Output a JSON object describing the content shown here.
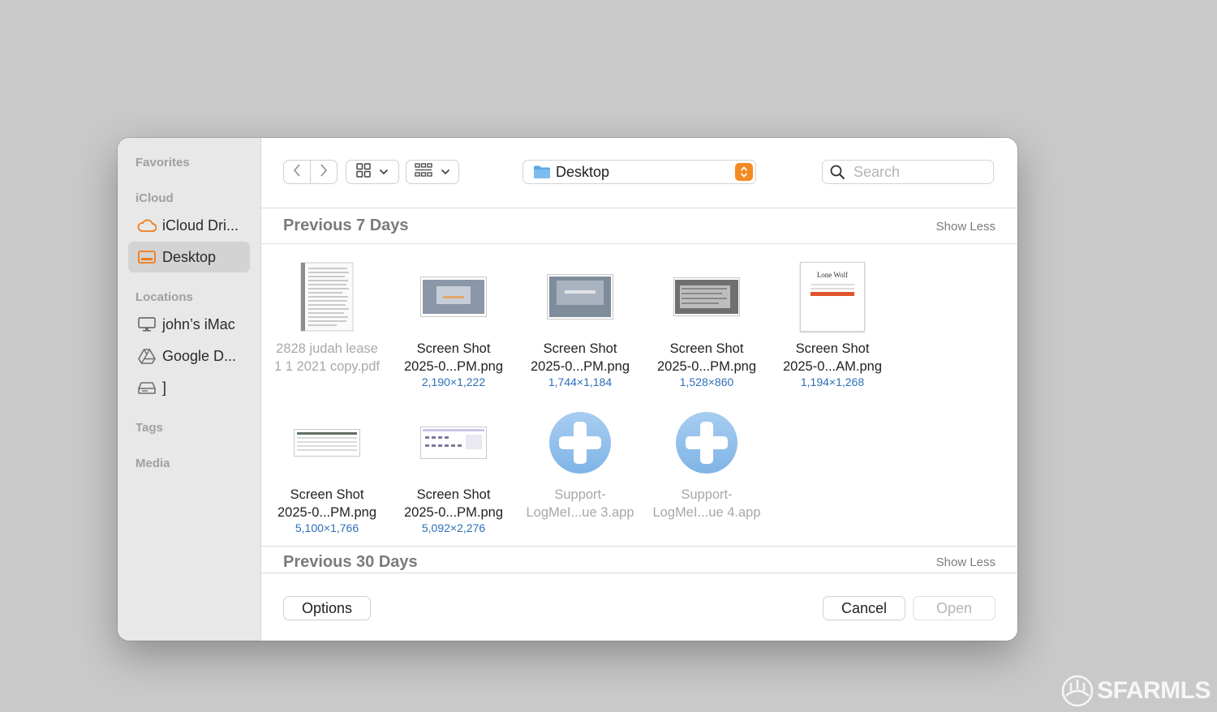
{
  "sidebar": {
    "favorites_label": "Favorites",
    "icloud_label": "iCloud",
    "icloud_items": [
      {
        "label": "iCloud Dri...",
        "icon": "cloud-icon"
      },
      {
        "label": "Desktop",
        "icon": "desktop-folder-icon",
        "selected": true
      }
    ],
    "locations_label": "Locations",
    "location_items": [
      {
        "label": "john’s iMac",
        "icon": "computer-icon"
      },
      {
        "label": "Google D...",
        "icon": "google-drive-icon"
      },
      {
        "label": "]",
        "icon": "external-drive-icon"
      }
    ],
    "tags_label": "Tags",
    "media_label": "Media"
  },
  "toolbar": {
    "location": "Desktop",
    "search_placeholder": "Search"
  },
  "sections": [
    {
      "title": "Previous 7 Days",
      "toggle": "Show Less",
      "files": [
        {
          "name_line1": "2828 judah lease",
          "name_line2": "1 1 2021 copy.pdf",
          "dims": "",
          "dim": true
        },
        {
          "name_line1": "Screen Shot",
          "name_line2": "2025-0...PM.png",
          "dims": "2,190×1,222"
        },
        {
          "name_line1": "Screen Shot",
          "name_line2": "2025-0...PM.png",
          "dims": "1,744×1,184"
        },
        {
          "name_line1": "Screen Shot",
          "name_line2": "2025-0...PM.png",
          "dims": "1,528×860"
        },
        {
          "name_line1": "Screen Shot",
          "name_line2": "2025-0...AM.png",
          "dims": "1,194×1,268",
          "thumb_text": "Lone Wolf"
        },
        {
          "name_line1": "Screen Shot",
          "name_line2": "2025-0...PM.png",
          "dims": "5,100×1,766"
        },
        {
          "name_line1": "Screen Shot",
          "name_line2": "2025-0...PM.png",
          "dims": "5,092×2,276"
        },
        {
          "name_line1": "Support-",
          "name_line2": "LogMeI...ue 3.app",
          "dims": "",
          "dim": true
        },
        {
          "name_line1": "Support-",
          "name_line2": "LogMeI...ue 4.app",
          "dims": "",
          "dim": true
        }
      ]
    },
    {
      "title": "Previous 30 Days",
      "toggle": "Show Less"
    }
  ],
  "footer": {
    "options_label": "Options",
    "cancel_label": "Cancel",
    "open_label": "Open"
  },
  "watermark": {
    "text": "SFARMLS"
  },
  "colors": {
    "accent_orange": "#f28a23",
    "folder_blue": "#5aa9e6",
    "dims_blue": "#2d6fb8"
  }
}
